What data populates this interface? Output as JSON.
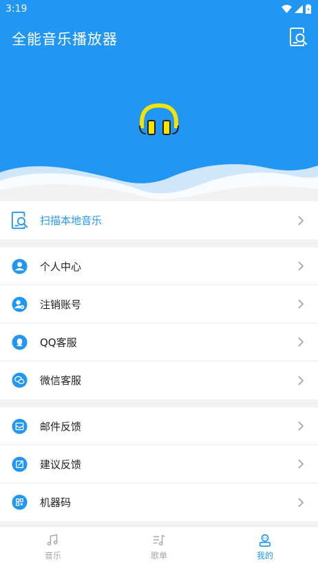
{
  "status": {
    "time": "3:19"
  },
  "header": {
    "title": "全能音乐播放器"
  },
  "scan_row": {
    "label": "扫描本地音乐"
  },
  "group1": [
    {
      "label": "个人中心",
      "icon": "person-icon"
    },
    {
      "label": "注销账号",
      "icon": "account-remove-icon"
    },
    {
      "label": "QQ客服",
      "icon": "qq-icon"
    },
    {
      "label": "微信客服",
      "icon": "wechat-icon"
    }
  ],
  "group2": [
    {
      "label": "邮件反馈",
      "icon": "mail-icon"
    },
    {
      "label": "建议反馈",
      "icon": "edit-note-icon"
    },
    {
      "label": "机器码",
      "icon": "qr-code-icon"
    }
  ],
  "nav": [
    {
      "label": "音乐",
      "icon": "music-note-icon",
      "active": false
    },
    {
      "label": "歌单",
      "icon": "playlist-icon",
      "active": false
    },
    {
      "label": "我的",
      "icon": "profile-icon",
      "active": true
    }
  ],
  "colors": {
    "primary": "#2196f3",
    "headphones": "#f5e400",
    "inactive": "#a6a6a6"
  }
}
